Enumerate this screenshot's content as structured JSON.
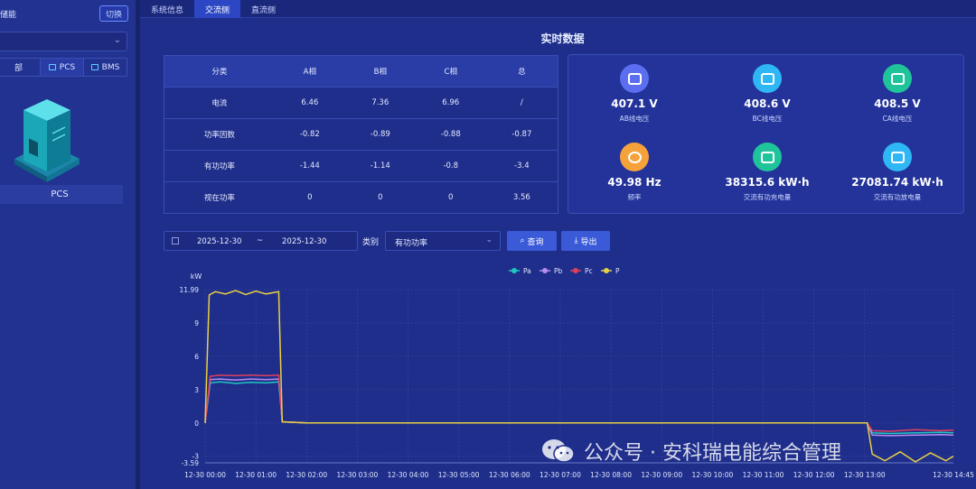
{
  "left_panel": {
    "title": "储能",
    "switch_label": "切换",
    "tabs": [
      {
        "label": "部",
        "active": false
      },
      {
        "label": "PCS",
        "active": true
      },
      {
        "label": "BMS",
        "active": false
      }
    ],
    "device_label": "PCS"
  },
  "top_tabs": [
    {
      "label": "系统信息",
      "active": false
    },
    {
      "label": "交流侧",
      "active": true
    },
    {
      "label": "直流侧",
      "active": false
    }
  ],
  "section_title": "实时数据",
  "table": {
    "headers": [
      "分类",
      "A相",
      "B相",
      "C相",
      "总"
    ],
    "rows": [
      [
        "电流",
        "6.46",
        "7.36",
        "6.96",
        "/"
      ],
      [
        "功率因数",
        "-0.82",
        "-0.89",
        "-0.88",
        "-0.87"
      ],
      [
        "有功功率",
        "-1.44",
        "-1.14",
        "-0.8",
        "-3.4"
      ],
      [
        "视在功率",
        "0",
        "0",
        "0",
        "3.56"
      ]
    ]
  },
  "cards": [
    {
      "value": "407.1 V",
      "label": "AB线电压",
      "color": "#5b6ef0",
      "icon": "gauge-icon"
    },
    {
      "value": "408.6 V",
      "label": "BC线电压",
      "color": "#2fb7f5",
      "icon": "gauge-icon"
    },
    {
      "value": "408.5 V",
      "label": "CA线电压",
      "color": "#20c49a",
      "icon": "gauge-icon"
    },
    {
      "value": "49.98 Hz",
      "label": "频率",
      "color": "#f5a23a",
      "icon": "frequency-icon"
    },
    {
      "value": "38315.6 kW·h",
      "label": "交流有功充电量",
      "color": "#20c49a",
      "icon": "battery-charge-icon"
    },
    {
      "value": "27081.74 kW·h",
      "label": "交流有功放电量",
      "color": "#2fb7f5",
      "icon": "battery-discharge-icon"
    }
  ],
  "filters": {
    "start_date": "2025-12-30",
    "separator": "~",
    "end_date": "2025-12-30",
    "category_label": "类别",
    "category_value": "有功功率",
    "query_label": "查询",
    "export_label": "导出"
  },
  "watermark": "公众号 · 安科瑞电能综合管理",
  "chart_data": {
    "type": "line",
    "ylabel": "kW",
    "y_ticks": [
      11.99,
      9,
      6,
      3,
      0,
      -3,
      -3.59
    ],
    "ylim": [
      -3.59,
      11.99
    ],
    "x_ticks": [
      "12-30 00:00",
      "12-30 01:00",
      "12-30 02:00",
      "12-30 03:00",
      "12-30 04:00",
      "12-30 05:00",
      "12-30 06:00",
      "12-30 07:00",
      "12-30 08:00",
      "12-30 09:00",
      "12-30 10:00",
      "12-30 11:00",
      "12-30 12:00",
      "12-30 13:00",
      "12-30 14:45"
    ],
    "legend_position": "top-center",
    "grid": true,
    "series": [
      {
        "name": "Pa",
        "color": "#1fc7c0",
        "points": [
          [
            0,
            0
          ],
          [
            0.1,
            3.6
          ],
          [
            0.3,
            3.7
          ],
          [
            0.6,
            3.55
          ],
          [
            0.9,
            3.65
          ],
          [
            1.2,
            3.6
          ],
          [
            1.45,
            3.7
          ],
          [
            1.52,
            0.1
          ],
          [
            2,
            0
          ],
          [
            4,
            0
          ],
          [
            6,
            0
          ],
          [
            8,
            0
          ],
          [
            10,
            0
          ],
          [
            12,
            0
          ],
          [
            13.05,
            0
          ],
          [
            13.15,
            -0.9
          ],
          [
            13.5,
            -0.95
          ],
          [
            14,
            -0.9
          ],
          [
            14.5,
            -0.85
          ],
          [
            14.75,
            -0.9
          ]
        ]
      },
      {
        "name": "Pb",
        "color": "#b58cf0",
        "points": [
          [
            0,
            0
          ],
          [
            0.1,
            3.9
          ],
          [
            0.3,
            3.95
          ],
          [
            0.6,
            3.85
          ],
          [
            0.9,
            3.95
          ],
          [
            1.2,
            3.9
          ],
          [
            1.45,
            3.95
          ],
          [
            1.52,
            0.1
          ],
          [
            2,
            0
          ],
          [
            4,
            0
          ],
          [
            6,
            0
          ],
          [
            8,
            0
          ],
          [
            10,
            0
          ],
          [
            12,
            0
          ],
          [
            13.05,
            0
          ],
          [
            13.15,
            -1.1
          ],
          [
            13.5,
            -1.15
          ],
          [
            14,
            -1.1
          ],
          [
            14.5,
            -1.05
          ],
          [
            14.75,
            -1.1
          ]
        ]
      },
      {
        "name": "Pc",
        "color": "#e0405a",
        "points": [
          [
            0,
            0
          ],
          [
            0.1,
            4.2
          ],
          [
            0.3,
            4.3
          ],
          [
            0.6,
            4.25
          ],
          [
            0.9,
            4.3
          ],
          [
            1.2,
            4.25
          ],
          [
            1.45,
            4.3
          ],
          [
            1.52,
            0.1
          ],
          [
            2,
            0
          ],
          [
            4,
            0
          ],
          [
            6,
            0
          ],
          [
            8,
            0
          ],
          [
            10,
            0
          ],
          [
            12,
            0
          ],
          [
            13.05,
            0
          ],
          [
            13.15,
            -0.7
          ],
          [
            13.5,
            -0.75
          ],
          [
            14,
            -0.6
          ],
          [
            14.5,
            -0.7
          ],
          [
            14.75,
            -0.65
          ]
        ]
      },
      {
        "name": "P",
        "color": "#e8d044",
        "points": [
          [
            0,
            0
          ],
          [
            0.08,
            11.5
          ],
          [
            0.2,
            11.8
          ],
          [
            0.4,
            11.6
          ],
          [
            0.6,
            11.9
          ],
          [
            0.8,
            11.55
          ],
          [
            1,
            11.85
          ],
          [
            1.2,
            11.6
          ],
          [
            1.45,
            11.8
          ],
          [
            1.52,
            0.1
          ],
          [
            2,
            0
          ],
          [
            4,
            0
          ],
          [
            6,
            0
          ],
          [
            8,
            0
          ],
          [
            10,
            0
          ],
          [
            12,
            0
          ],
          [
            13.05,
            0
          ],
          [
            13.15,
            -2.8
          ],
          [
            13.4,
            -3.4
          ],
          [
            13.7,
            -2.6
          ],
          [
            14,
            -3.5
          ],
          [
            14.3,
            -2.7
          ],
          [
            14.6,
            -3.4
          ],
          [
            14.75,
            -3.0
          ]
        ]
      }
    ]
  }
}
